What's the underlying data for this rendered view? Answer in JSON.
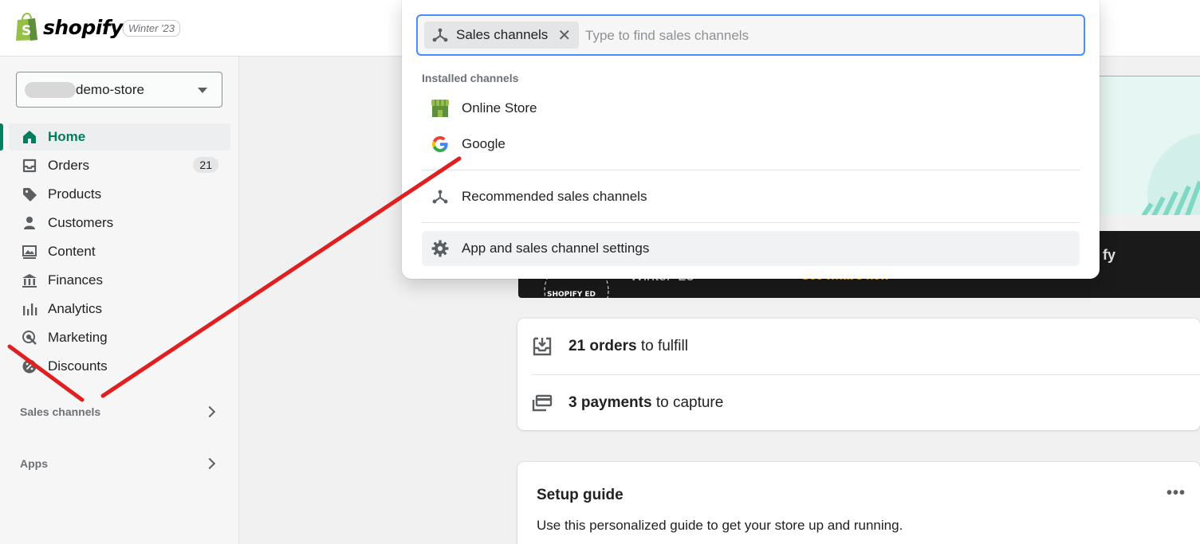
{
  "topbar": {
    "logo_text": "shopify",
    "edition_badge": "Winter '23"
  },
  "sidebar": {
    "store_name": "demo-store",
    "items": [
      {
        "label": "Home",
        "icon": "home-icon",
        "active": true
      },
      {
        "label": "Orders",
        "icon": "orders-icon",
        "count": "21"
      },
      {
        "label": "Products",
        "icon": "tag-icon"
      },
      {
        "label": "Customers",
        "icon": "person-icon"
      },
      {
        "label": "Content",
        "icon": "content-icon"
      },
      {
        "label": "Finances",
        "icon": "bank-icon"
      },
      {
        "label": "Analytics",
        "icon": "analytics-icon"
      },
      {
        "label": "Marketing",
        "icon": "marketing-icon"
      },
      {
        "label": "Discounts",
        "icon": "discount-icon"
      }
    ],
    "sections": [
      {
        "label": "Sales channels"
      },
      {
        "label": "Apps"
      }
    ]
  },
  "popover": {
    "chip_label": "Sales channels",
    "search_placeholder": "Type to find sales channels",
    "installed_heading": "Installed channels",
    "installed": [
      {
        "label": "Online Store",
        "icon": "online-store-icon"
      },
      {
        "label": "Google",
        "icon": "google-icon"
      }
    ],
    "recommended_label": "Recommended sales channels",
    "settings_label": "App and sales channel settings"
  },
  "main": {
    "banner": {
      "text_left": "Winter '23",
      "link_text": "See what's new",
      "partial_right": "fy"
    },
    "tasks": [
      {
        "bold": "21 orders",
        "rest": " to fulfill",
        "icon": "inbox-download-icon"
      },
      {
        "bold": "3 payments",
        "rest": " to capture",
        "icon": "credit-card-icon"
      }
    ],
    "setup_guide": {
      "title": "Setup guide",
      "subtitle": "Use this personalized guide to get your store up and running.",
      "menu": "•••"
    }
  },
  "colors": {
    "accent_green": "#008060",
    "focus_blue": "#458fff",
    "annotation_red": "#e02020"
  }
}
